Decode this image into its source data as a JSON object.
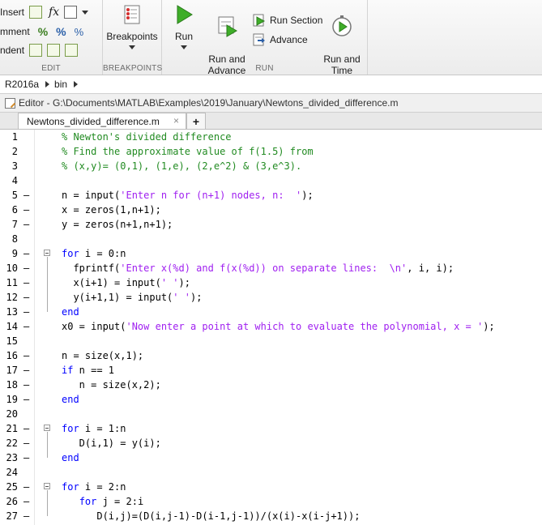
{
  "ribbon": {
    "edit": {
      "rows": [
        "Insert",
        "mment",
        "ndent"
      ],
      "fx_label": "fx",
      "group_label": "EDIT"
    },
    "breakpoints": {
      "button_label": "Breakpoints",
      "group_label": "BREAKPOINTS"
    },
    "run": {
      "run_label": "Run",
      "run_advance_label": "Run and\nAdvance",
      "run_section_label": "Run Section",
      "advance_label": "Advance",
      "run_time_label": "Run and\nTime",
      "group_label": "RUN"
    }
  },
  "breadcrumb": [
    "R2016a",
    "bin"
  ],
  "editor": {
    "title": "Editor - G:\\Documents\\MATLAB\\Examples\\2019\\January\\Newtons_divided_difference.m",
    "tab_label": "Newtons_divided_difference.m",
    "tab_close": "×",
    "new_tab": "+"
  },
  "code_lines": [
    {
      "n": "1",
      "dash": false,
      "text": "% Newton's divided difference"
    },
    {
      "n": "2",
      "dash": false,
      "text": "% Find the approximate value of f(1.5) from"
    },
    {
      "n": "3",
      "dash": false,
      "text": "% (x,y)= (0,1), (1,e), (2,e^2) & (3,e^3)."
    },
    {
      "n": "4",
      "dash": false,
      "text": ""
    },
    {
      "n": "5",
      "dash": true,
      "text": "n = input('Enter n for (n+1) nodes, n:  ');"
    },
    {
      "n": "6",
      "dash": true,
      "text": "x = zeros(1,n+1);"
    },
    {
      "n": "7",
      "dash": true,
      "text": "y = zeros(n+1,n+1);"
    },
    {
      "n": "8",
      "dash": false,
      "text": ""
    },
    {
      "n": "9",
      "dash": true,
      "text": "for i = 0:n"
    },
    {
      "n": "10",
      "dash": true,
      "text": "  fprintf('Enter x(%d) and f(x(%d)) on separate lines:  \\n', i, i);"
    },
    {
      "n": "11",
      "dash": true,
      "text": "  x(i+1) = input(' ');"
    },
    {
      "n": "12",
      "dash": true,
      "text": "  y(i+1,1) = input(' ');"
    },
    {
      "n": "13",
      "dash": true,
      "text": "end"
    },
    {
      "n": "14",
      "dash": true,
      "text": "x0 = input('Now enter a point at which to evaluate the polynomial, x = ');"
    },
    {
      "n": "15",
      "dash": false,
      "text": ""
    },
    {
      "n": "16",
      "dash": true,
      "text": "n = size(x,1);"
    },
    {
      "n": "17",
      "dash": true,
      "text": "if n == 1"
    },
    {
      "n": "18",
      "dash": true,
      "text": "   n = size(x,2);"
    },
    {
      "n": "19",
      "dash": true,
      "text": "end"
    },
    {
      "n": "20",
      "dash": false,
      "text": ""
    },
    {
      "n": "21",
      "dash": true,
      "text": "for i = 1:n"
    },
    {
      "n": "22",
      "dash": true,
      "text": "   D(i,1) = y(i);"
    },
    {
      "n": "23",
      "dash": true,
      "text": "end"
    },
    {
      "n": "24",
      "dash": false,
      "text": ""
    },
    {
      "n": "25",
      "dash": true,
      "text": "for i = 2:n"
    },
    {
      "n": "26",
      "dash": true,
      "text": "   for j = 2:i"
    },
    {
      "n": "27",
      "dash": true,
      "text": "      D(i,j)=(D(i,j-1)-D(i-1,j-1))/(x(i)-x(i-j+1));"
    }
  ],
  "colors": {
    "keyword": "#0000ff",
    "comment": "#228b22",
    "string": "#a020f0"
  }
}
